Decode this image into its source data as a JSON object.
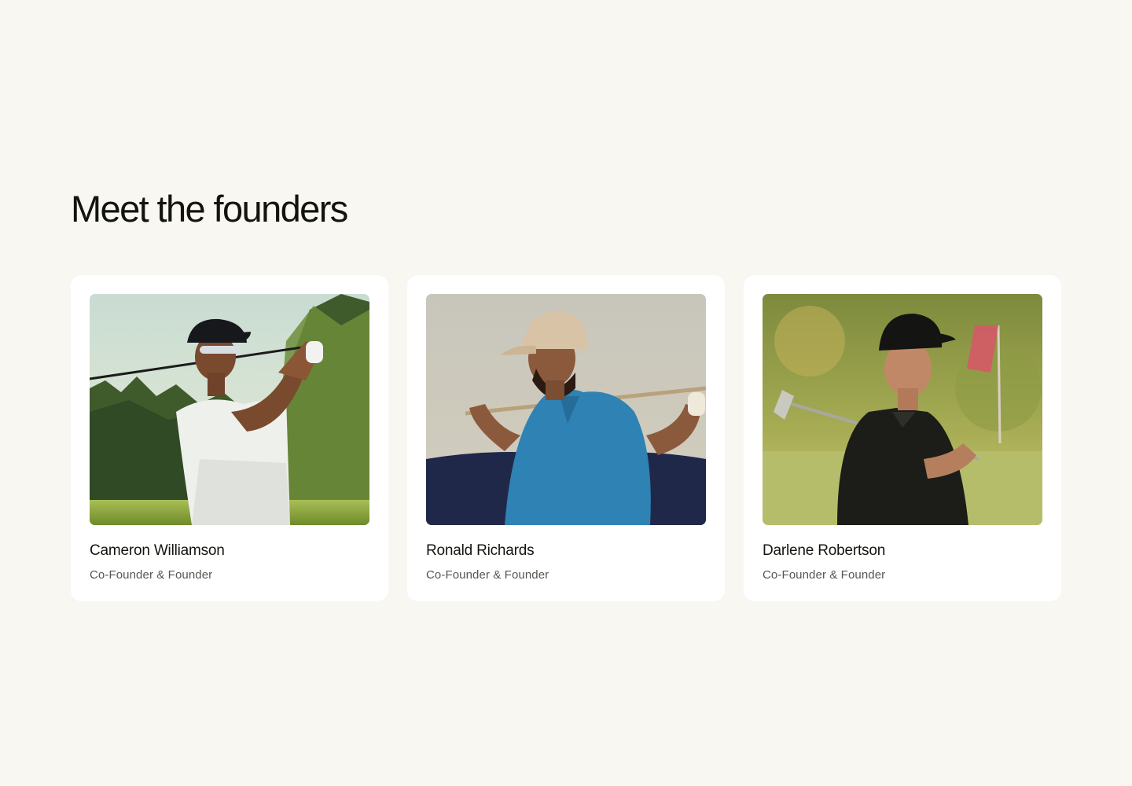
{
  "section": {
    "title": "Meet the founders"
  },
  "founders": [
    {
      "name": "Cameron Williamson",
      "role": "Co-Founder & Founder",
      "photo": "golfer-swing-photo"
    },
    {
      "name": "Ronald Richards",
      "role": "Co-Founder & Founder",
      "photo": "golfer-club-on-shoulders-photo"
    },
    {
      "name": "Darlene Robertson",
      "role": "Co-Founder & Founder",
      "photo": "golfer-holding-club-photo"
    }
  ],
  "colors": {
    "background": "#f8f7f2",
    "card": "#ffffff",
    "text": "#14150f",
    "muted": "#55574f"
  }
}
